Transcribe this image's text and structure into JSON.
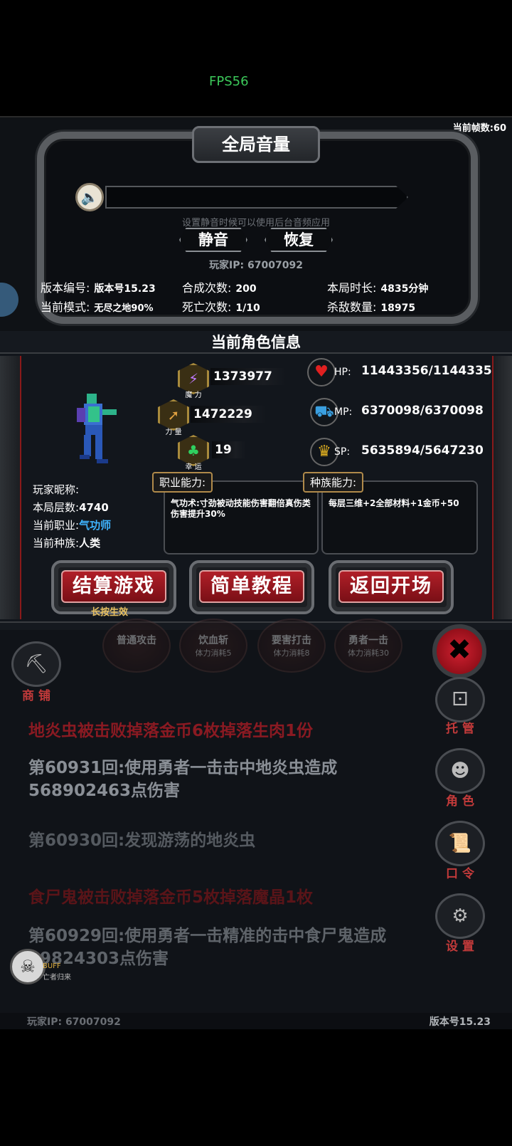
{
  "overlay": {
    "fps": "FPS56"
  },
  "top": {
    "current_fps": "当前帧数:60",
    "volume_title": "全局音量",
    "volume_level": 0,
    "volume_hint": "设置静音时候可以使用后台音频应用",
    "mute_label": "静音",
    "restore_label": "恢复",
    "ip_line": "玩家IP:  67007092"
  },
  "stats": {
    "version_label": "版本编号:",
    "version_value": "版本号15.23",
    "synth_label": "合成次数:",
    "synth_value": "200",
    "duration_label": "本局时长:",
    "duration_value": "4835分钟",
    "mode_label": "当前模式:",
    "mode_value": "无尽之地90%",
    "death_label": "死亡次数:",
    "death_value": "1/10",
    "kills_label": "杀敌数量:",
    "kills_value": "18975"
  },
  "character": {
    "header": "当前角色信息",
    "magic_value": "1373977",
    "magic_caption": "魔 力",
    "strength_value": "1472229",
    "strength_caption": "力 量",
    "luck_value": "19",
    "luck_caption": "幸 运",
    "hp_label": "HP:",
    "hp_value": "11443356/11443356",
    "mp_label": "MP:",
    "mp_value": "6370098/6370098",
    "sp_label": "SP:",
    "sp_value": "5635894/5647230",
    "job_ability_header": "职业能力:",
    "job_ability_text": "气功术:寸劲被动技能伤害翻倍真伤类伤害提升30%",
    "race_ability_header": "种族能力:",
    "race_ability_text": "每层三维+2全部材料+1金币+50",
    "nick_label": "玩家昵称:",
    "floor_label": "本局层数:",
    "floor_value": "4740",
    "job_label": "当前职业:",
    "job_value": "气功师",
    "race_label": "当前种族:",
    "race_value": "人类",
    "colors": {
      "job_value": "#3fb4ff"
    }
  },
  "buttons": {
    "settle": "结算游戏",
    "settle_hint": "长按生效",
    "tutorial": "简单教程",
    "back": "返回开场"
  },
  "skills": [
    {
      "name": "普通攻击",
      "cost": ""
    },
    {
      "name": "饮血斩",
      "cost": "体力消耗5"
    },
    {
      "name": "要害打击",
      "cost": "体力消耗8"
    },
    {
      "name": "勇者一击",
      "cost": "体力消耗30"
    }
  ],
  "side": {
    "shop": "商 铺",
    "auto": "托 管",
    "role": "角 色",
    "code": "口 令",
    "settings": "设 置",
    "buff": "BUFF",
    "buff_name": "亡者归来"
  },
  "log": [
    "地炎虫被击败掉落金币6枚掉落生肉1份",
    "第60931回:使用勇者一击击中地炎虫造成568902463点伤害",
    "第60930回:发现游荡的地炎虫",
    "食尸鬼被击败掉落金币5枚掉落魔晶1枚",
    "第60929回:使用勇者一击精准的击中食尸鬼造成19824303点伤害"
  ],
  "footer": {
    "ip": "玩家IP:  67007092",
    "version": "版本号15.23"
  }
}
